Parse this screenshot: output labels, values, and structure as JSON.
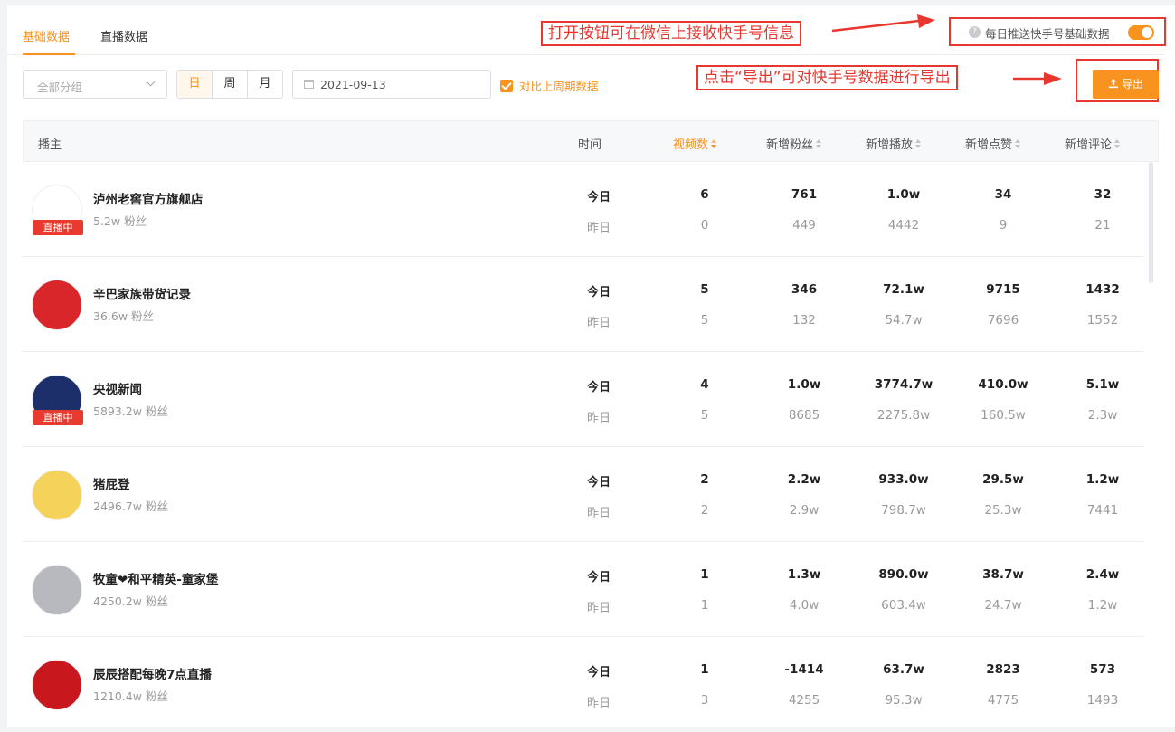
{
  "tabs": [
    {
      "label": "基础数据",
      "active": true
    },
    {
      "label": "直播数据",
      "active": false
    }
  ],
  "annotations": {
    "push_note": "打开按钮可在微信上接收快手号信息",
    "export_note": "点击“导出”可对快手号数据进行导出"
  },
  "push": {
    "help": "?",
    "label": "每日推送快手号基础数据",
    "enabled": true
  },
  "filters": {
    "group_placeholder": "全部分组",
    "periods": [
      "日",
      "周",
      "月"
    ],
    "active_period": "日",
    "date": "2021-09-13",
    "compare_label": "对比上周期数据",
    "compare_checked": true
  },
  "export_label": "导出",
  "columns": {
    "anchor": "播主",
    "time": "时间",
    "videos": "视频数",
    "fans": "新增粉丝",
    "plays": "新增播放",
    "likes": "新增点赞",
    "comments": "新增评论"
  },
  "today_label": "今日",
  "yesterday_label": "昨日",
  "live_badge": "直播中",
  "rows": [
    {
      "name": "泸州老窖官方旗舰店",
      "fans": "5.2w 粉丝",
      "live": true,
      "avatar_color": "#ffffff",
      "today": [
        "6",
        "761",
        "1.0w",
        "34",
        "32"
      ],
      "yesterday": [
        "0",
        "449",
        "4442",
        "9",
        "21"
      ]
    },
    {
      "name": "辛巴家族带货记录",
      "fans": "36.6w 粉丝",
      "live": false,
      "avatar_color": "#d8262b",
      "today": [
        "5",
        "346",
        "72.1w",
        "9715",
        "1432"
      ],
      "yesterday": [
        "5",
        "132",
        "54.7w",
        "7696",
        "1552"
      ]
    },
    {
      "name": "央视新闻",
      "fans": "5893.2w 粉丝",
      "live": true,
      "avatar_color": "#1d2f6b",
      "today": [
        "4",
        "1.0w",
        "3774.7w",
        "410.0w",
        "5.1w"
      ],
      "yesterday": [
        "5",
        "8685",
        "2275.8w",
        "160.5w",
        "2.3w"
      ]
    },
    {
      "name": "猪屁登",
      "fans": "2496.7w 粉丝",
      "live": false,
      "avatar_color": "#f5d35a",
      "today": [
        "2",
        "2.2w",
        "933.0w",
        "29.5w",
        "1.2w"
      ],
      "yesterday": [
        "2",
        "2.9w",
        "798.7w",
        "25.3w",
        "7441"
      ]
    },
    {
      "name": "牧童❤和平精英-童家堡",
      "fans": "4250.2w 粉丝",
      "live": false,
      "avatar_color": "#b8b8bf",
      "today": [
        "1",
        "1.3w",
        "890.0w",
        "38.7w",
        "2.4w"
      ],
      "yesterday": [
        "1",
        "4.0w",
        "603.4w",
        "24.7w",
        "1.2w"
      ]
    },
    {
      "name": "辰辰搭配每晚7点直播",
      "fans": "1210.4w 粉丝",
      "live": false,
      "avatar_color": "#c8171d",
      "today": [
        "1",
        "-1414",
        "63.7w",
        "2823",
        "573"
      ],
      "yesterday": [
        "3",
        "4255",
        "95.3w",
        "4775",
        "1493"
      ]
    }
  ],
  "colors": {
    "accent": "#f7931e",
    "annotation": "#e8372f"
  }
}
